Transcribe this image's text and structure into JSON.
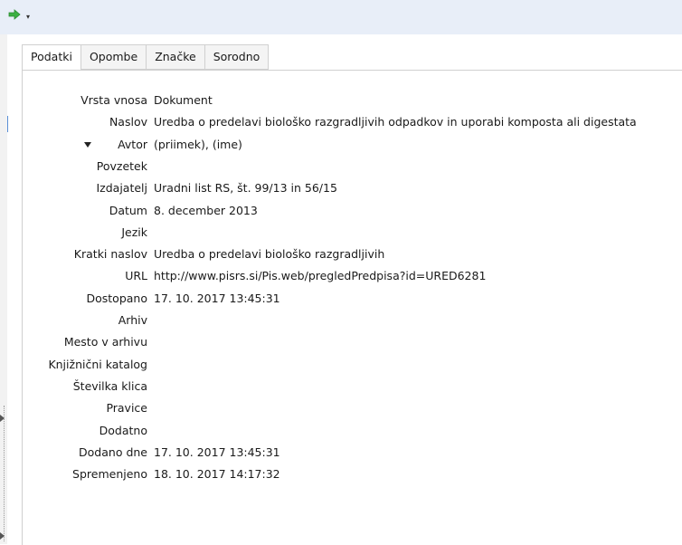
{
  "toolbar": {
    "button_icon": "green-arrow-icon",
    "chevron": "▾"
  },
  "tabs": [
    {
      "label": "Podatki",
      "active": true
    },
    {
      "label": "Opombe",
      "active": false
    },
    {
      "label": "Značke",
      "active": false
    },
    {
      "label": "Sorodno",
      "active": false
    }
  ],
  "fields": [
    {
      "label": "Vrsta vnosa",
      "value": "Dokument"
    },
    {
      "label": "Naslov",
      "value": "Uredba o predelavi biološko razgradljivih odpadkov in uporabi komposta ali digestata"
    },
    {
      "label": "Avtor",
      "value": "(priimek), (ime)"
    },
    {
      "label": "Povzetek",
      "value": ""
    },
    {
      "label": "Izdajatelj",
      "value": "Uradni list RS, št. 99/13 in 56/15"
    },
    {
      "label": "Datum",
      "value": "8. december 2013"
    },
    {
      "label": "Jezik",
      "value": ""
    },
    {
      "label": "Kratki naslov",
      "value": "Uredba o predelavi biološko razgradljivih"
    },
    {
      "label": "URL",
      "value": "http://www.pisrs.si/Pis.web/pregledPredpisa?id=URED6281"
    },
    {
      "label": "Dostopano",
      "value": "17. 10. 2017 13:45:31"
    },
    {
      "label": "Arhiv",
      "value": ""
    },
    {
      "label": "Mesto v arhivu",
      "value": ""
    },
    {
      "label": "Knjižnični katalog",
      "value": ""
    },
    {
      "label": "Številka klica",
      "value": ""
    },
    {
      "label": "Pravice",
      "value": ""
    },
    {
      "label": "Dodatno",
      "value": ""
    },
    {
      "label": "Dodano dne",
      "value": "17. 10. 2017 13:45:31"
    },
    {
      "label": "Spremenjeno",
      "value": "18. 10. 2017 14:17:32"
    }
  ]
}
